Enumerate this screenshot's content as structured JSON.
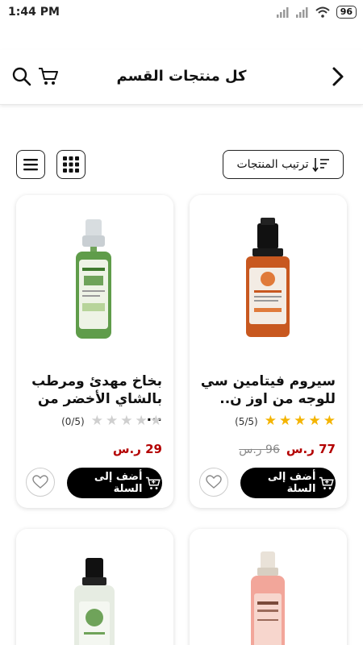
{
  "status_bar": {
    "time": "1:44 PM",
    "battery": "96"
  },
  "header": {
    "title": "كل منتجات القسم"
  },
  "toolbar": {
    "sort_label": "ترتيب المنتجات"
  },
  "products": [
    {
      "name": "سيروم فيتامين سي للوجه من اوز ن..",
      "rating": 5,
      "rating_text": "(5/5)",
      "price": "77 ر.س",
      "old_price": "96 ر.س",
      "add_label": "أضف إلى السلة"
    },
    {
      "name": "بخاخ مهدئ ومرطب بالشاي الأخضر من ...",
      "rating": 0,
      "rating_text": "(0/5)",
      "price": "29 ر.س",
      "old_price": "",
      "add_label": "أضف إلى السلة"
    }
  ],
  "colors": {
    "accent": "#000000",
    "price": "#b30000",
    "star_on": "#f4b400",
    "star_off": "#cfcfcf"
  },
  "icons": [
    "back-arrow-icon",
    "cart-icon",
    "search-icon",
    "sort-icon",
    "grid-view-icon",
    "list-view-icon",
    "heart-icon",
    "add-to-cart-icon",
    "star-icon"
  ]
}
